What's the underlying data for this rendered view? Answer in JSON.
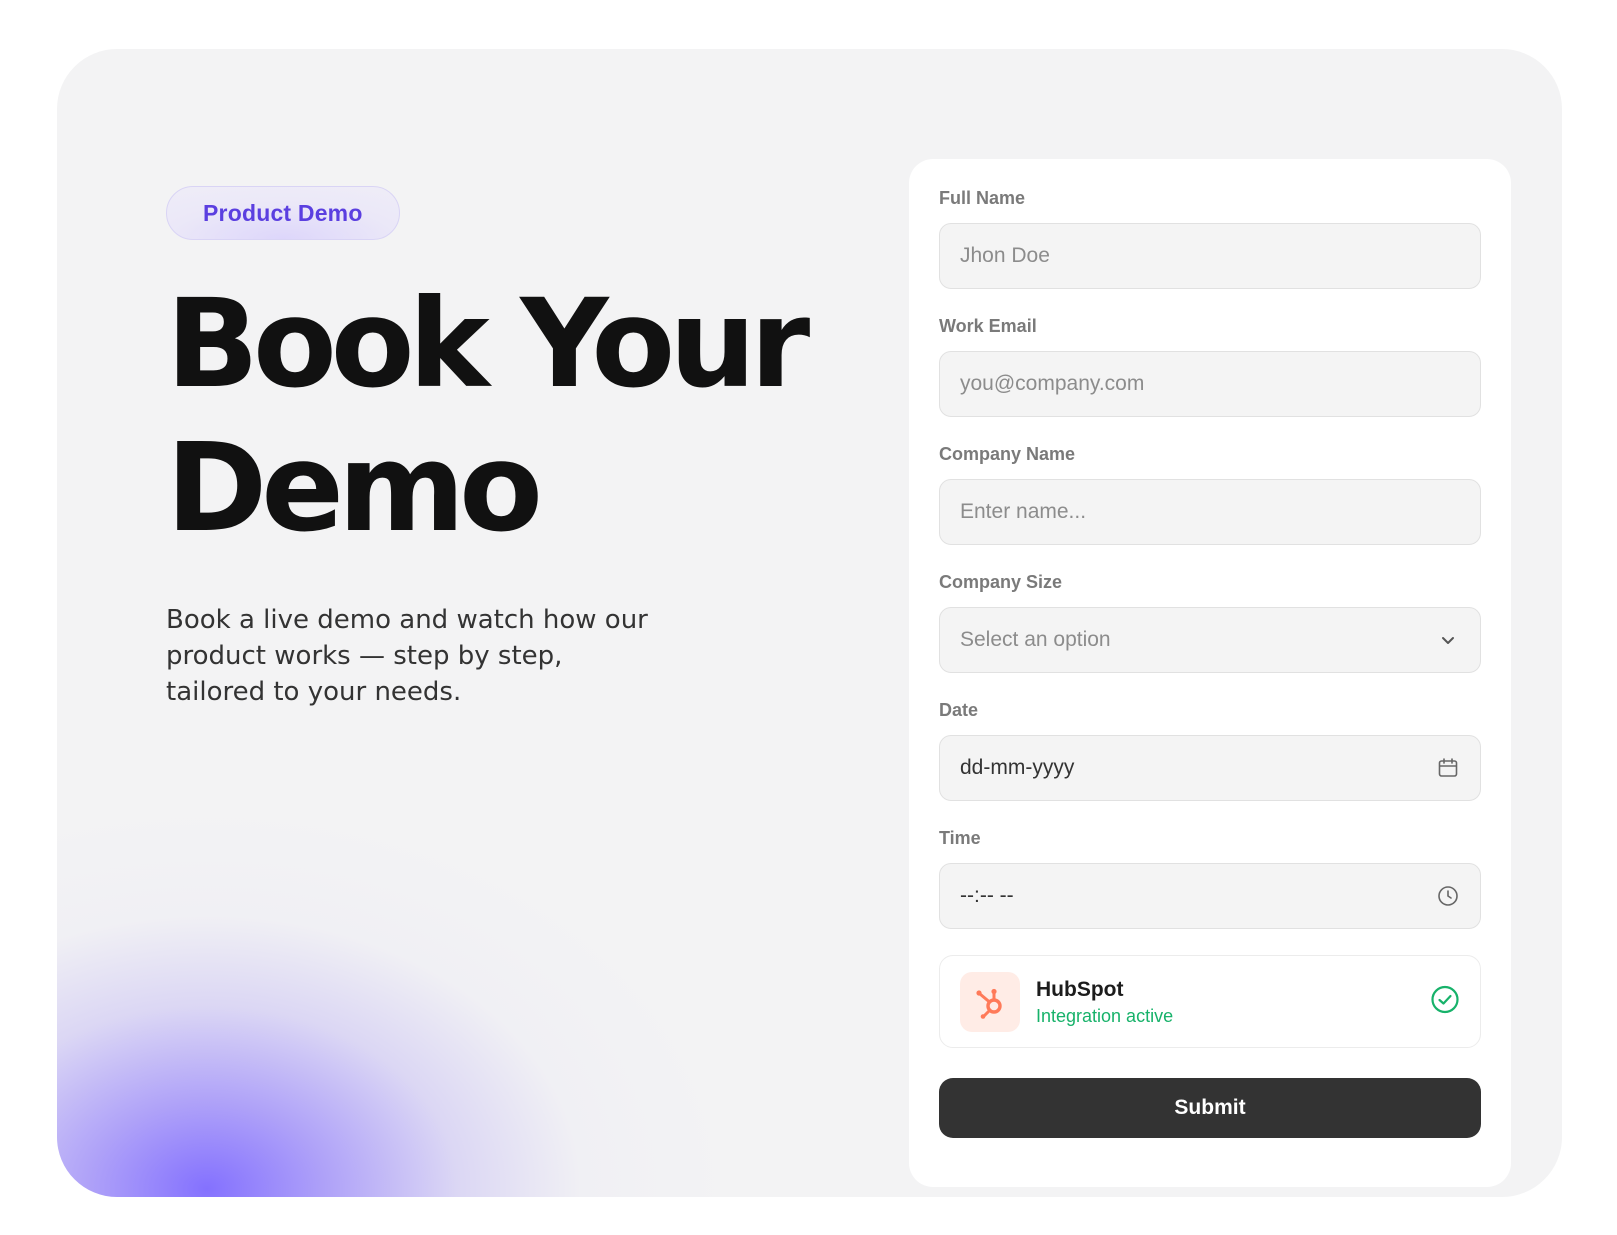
{
  "badge": "Product Demo",
  "headline": {
    "line1": "Book Your",
    "line2": "Demo"
  },
  "subtitle": "Book a live demo and watch how our product works — step by step, tailored to your needs.",
  "form": {
    "full_name": {
      "label": "Full Name",
      "placeholder": "Jhon Doe"
    },
    "work_email": {
      "label": "Work Email",
      "placeholder": "you@company.com"
    },
    "company_name": {
      "label": "Company Name",
      "placeholder": "Enter name..."
    },
    "company_size": {
      "label": "Company Size",
      "selected": "Select an option",
      "icon": "chevron-down-icon"
    },
    "date": {
      "label": "Date",
      "value": "dd-mm-yyyy",
      "icon": "calendar-icon"
    },
    "time": {
      "label": "Time",
      "value": "--:-- --",
      "icon": "clock-icon"
    },
    "integration": {
      "name": "HubSpot",
      "status": "Integration active",
      "icon": "hubspot-logo-icon",
      "status_icon": "check-circle-icon"
    },
    "submit_label": "Submit"
  },
  "colors": {
    "accent": "#5b3fe0",
    "integration_status": "#17b26a",
    "hubspot": "#ff7a59",
    "submit_bg": "#333333"
  }
}
